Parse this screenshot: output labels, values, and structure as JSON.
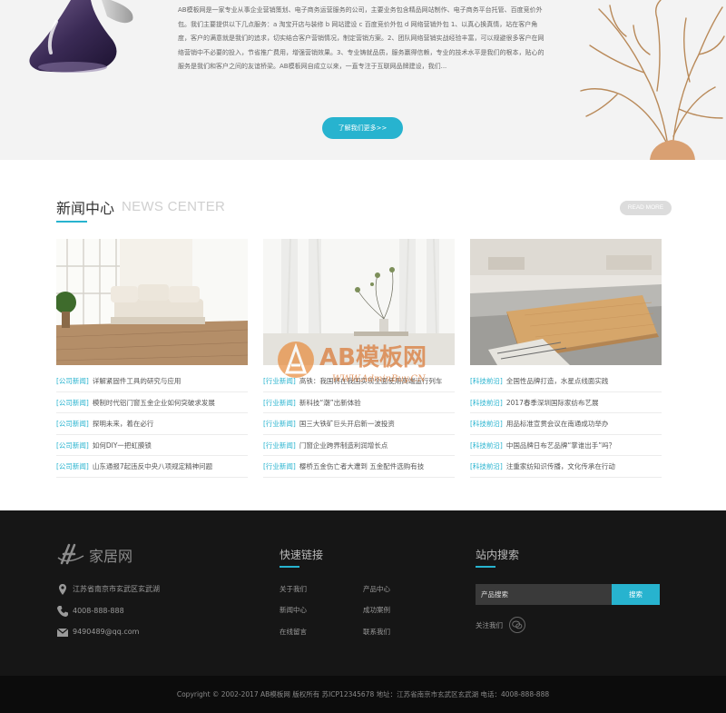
{
  "about": {
    "text": "AB模板网是一家专业从事企业营销策划、电子商务运营服务的公司，主要业务包含精品网站制作、电子商务平台托管、百度竞价外包。我们主要提供以下几点服务：a 淘宝开店与装修 b 网站建设 c 百度竞价外包 d 网络营销外包 1、以真心换真情，站在客户角度，客户的满意就是我们的追求，切实结合客户营销情况，制定营销方案。2、团队网络营销实战经验丰富，可以规避很多客户在网络营销中不必要的投入，节省推广费用，增强营销效果。3、专业铸就品质，服务赢得信赖，专业的技术水平是我们的根本，贴心的服务是我们和客户之间的友谊桥梁。AB模板网自成立以来，一直专注于互联网品牌建设，我们...",
    "button": "了解我们更多>>"
  },
  "news": {
    "title": "新闻中心",
    "title_en": "NEWS CENTER",
    "read_more": "READ MORE",
    "columns": [
      {
        "items": [
          {
            "cat": "[公司新闻]",
            "title": "详解紧固件工具的研究与应用"
          },
          {
            "cat": "[公司新闻]",
            "title": "模制时代铝门窗五金企业如何突破求发展"
          },
          {
            "cat": "[公司新闻]",
            "title": "探明未来，着在必行"
          },
          {
            "cat": "[公司新闻]",
            "title": "如何DIY一把虹膜锁"
          },
          {
            "cat": "[公司新闻]",
            "title": "山东通报7起违反中央八项规定精神问题"
          }
        ]
      },
      {
        "items": [
          {
            "cat": "[行业新闻]",
            "title": "高铁：我国将在我国实现全面使用高端运行列车"
          },
          {
            "cat": "[行业新闻]",
            "title": "新科技“潮”出新体验"
          },
          {
            "cat": "[行业新闻]",
            "title": "国三大铁矿巨头开启新一波投资"
          },
          {
            "cat": "[行业新闻]",
            "title": "门窗企业跨界制造利润增长点"
          },
          {
            "cat": "[行业新闻]",
            "title": "樱桥五金伤亡者大遭到 五金配件选购有技"
          }
        ]
      },
      {
        "items": [
          {
            "cat": "[科技前沿]",
            "title": "全国性品牌打造，水星点线面实践"
          },
          {
            "cat": "[科技前沿]",
            "title": "2017春季深圳国际家纺布艺展"
          },
          {
            "cat": "[科技前沿]",
            "title": "用品标准宣贯会议在南通成功举办"
          },
          {
            "cat": "[科技前沿]",
            "title": "中国品牌日布艺品牌“掌谁出手”吗？"
          },
          {
            "cat": "[科技前沿]",
            "title": "注重家纺知识传播，文化传承在行动"
          }
        ]
      }
    ]
  },
  "watermark": {
    "main": "AB模板网",
    "url": "WWW.AdminBuy.CN"
  },
  "footer": {
    "logo_text": "家居网",
    "contact": {
      "address": "江苏省南京市玄武区玄武湖",
      "phone": "4008-888-888",
      "email": "9490489@qq.com"
    },
    "quick_links_title": "快速链接",
    "quick_links": [
      "关于我们",
      "产品中心",
      "新闻中心",
      "成功案例",
      "在线留言",
      "联系我们"
    ],
    "search_title": "站内搜索",
    "search_placeholder": "产品搜索",
    "search_button": "搜索",
    "follow": "关注我们",
    "copyright": "Copyright © 2002-2017 AB模板网 版权所有  苏ICP12345678  地址：江苏省南京市玄武区玄武湖  电话：4008-888-888"
  },
  "colors": {
    "accent": "#27b3cf",
    "footer_bg": "#161616",
    "bottom_bg": "#0c0c0c",
    "about_bg": "#f3f3f3"
  }
}
